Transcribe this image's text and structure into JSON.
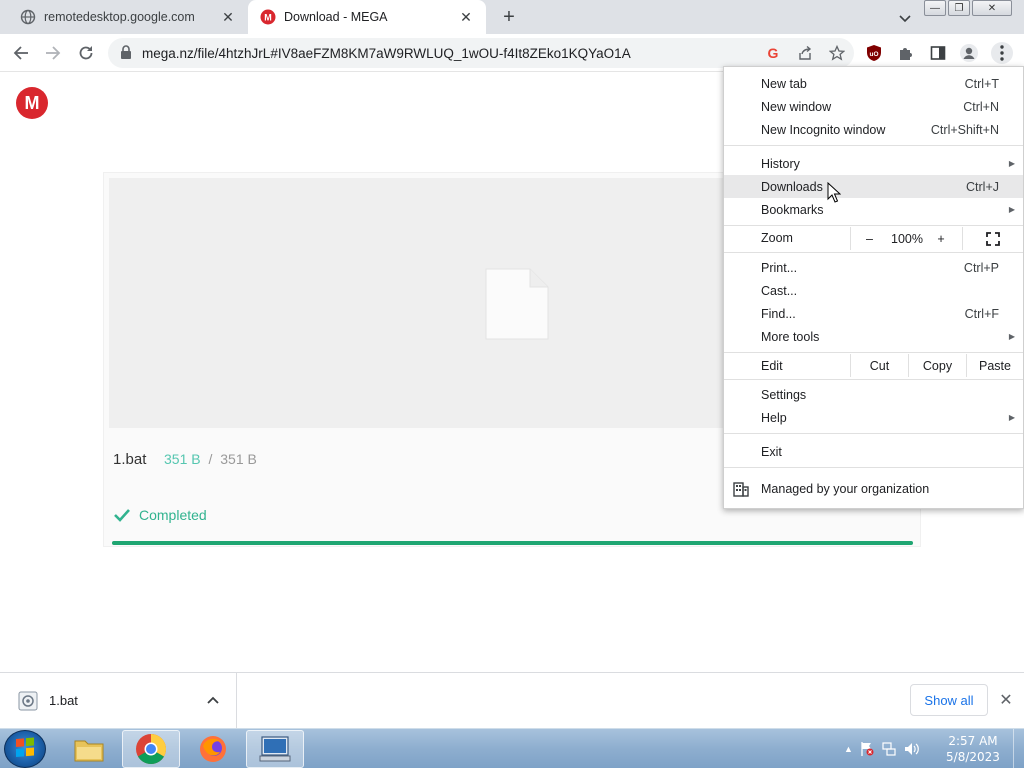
{
  "tabs": [
    {
      "title": "remotedesktop.google.com",
      "active": false,
      "favicon": "globe-icon"
    },
    {
      "title": "Download - MEGA",
      "active": true,
      "favicon": "mega-icon"
    }
  ],
  "address_bar": {
    "url": "mega.nz/file/4htzhJrL#IV8aeFZM8KM7aW9RWLUQ_1wOU-f4It8ZEko1KQYaO1A"
  },
  "page": {
    "logo_letter": "M",
    "file": {
      "name": "1.bat",
      "downloaded": "351 B",
      "separator": "/",
      "total": "351 B"
    },
    "status": "Completed",
    "progress_fraction": 1.0
  },
  "menu": {
    "group1": [
      {
        "label": "New tab",
        "shortcut": "Ctrl+T"
      },
      {
        "label": "New window",
        "shortcut": "Ctrl+N"
      },
      {
        "label": "New Incognito window",
        "shortcut": "Ctrl+Shift+N"
      }
    ],
    "group2": [
      {
        "label": "History",
        "shortcut": ""
      },
      {
        "label": "Downloads",
        "shortcut": "Ctrl+J"
      },
      {
        "label": "Bookmarks",
        "shortcut": ""
      }
    ],
    "zoom": {
      "label": "Zoom",
      "minus": "–",
      "value": "100%",
      "plus": "+"
    },
    "group3": [
      {
        "label": "Print...",
        "shortcut": "Ctrl+P"
      },
      {
        "label": "Cast...",
        "shortcut": ""
      },
      {
        "label": "Find...",
        "shortcut": "Ctrl+F"
      },
      {
        "label": "More tools",
        "shortcut": ""
      }
    ],
    "edit": {
      "label": "Edit",
      "cut": "Cut",
      "copy": "Copy",
      "paste": "Paste"
    },
    "group4": [
      {
        "label": "Settings",
        "shortcut": ""
      },
      {
        "label": "Help",
        "shortcut": ""
      }
    ],
    "exit": "Exit",
    "managed": "Managed by your organization"
  },
  "download_bar": {
    "item_name": "1.bat",
    "show_all": "Show all"
  },
  "taskbar": {
    "time": "2:57 AM",
    "date": "5/8/2023"
  },
  "colors": {
    "mega_red": "#d9272e",
    "completed_green": "#31b38f",
    "progress_green": "#1fa672",
    "link_blue": "#1a73e8"
  }
}
